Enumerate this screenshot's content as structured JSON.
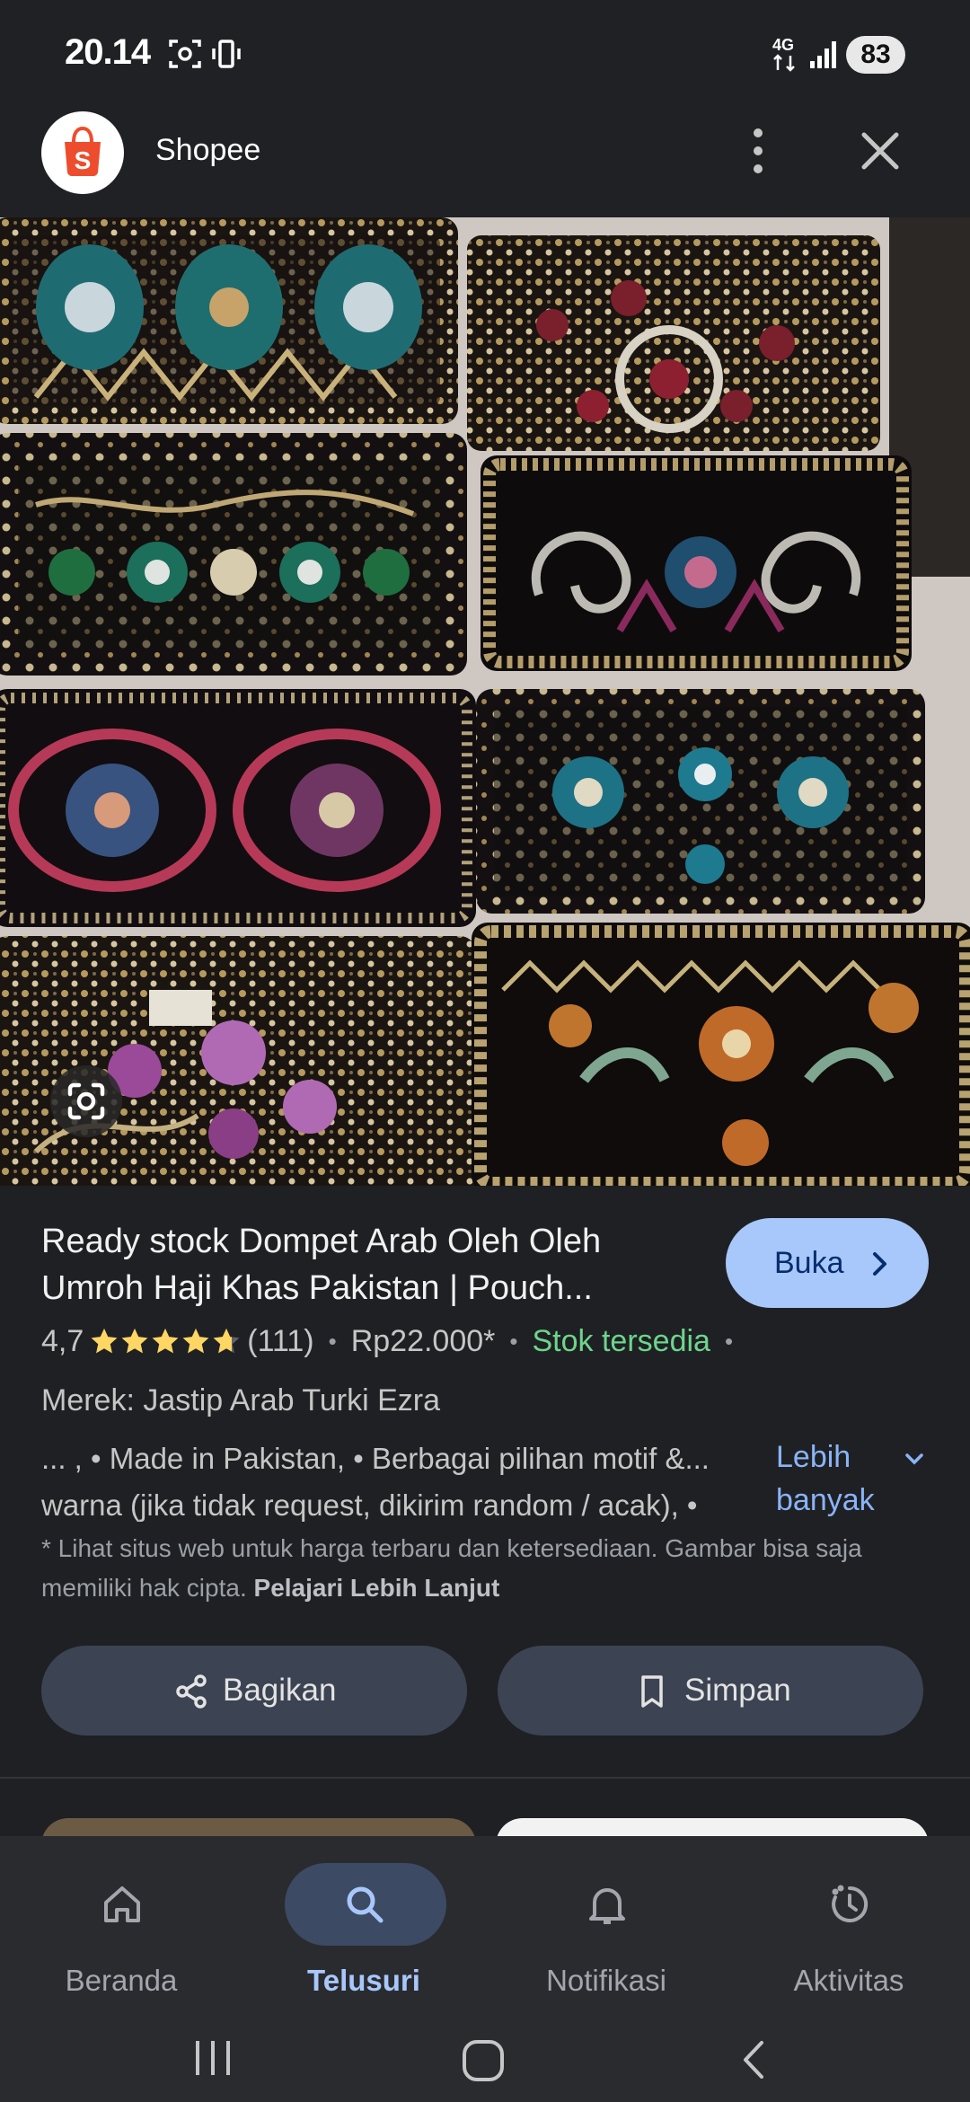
{
  "status_bar": {
    "time": "20.14",
    "network": "4G",
    "battery": "83"
  },
  "source": {
    "name": "Shopee",
    "logo_letter": "S",
    "logo_color": "#ee4d2d"
  },
  "product": {
    "title_line1": "Ready stock Dompet Arab Oleh Oleh",
    "title_line2": "Umroh Haji Khas Pakistan | Pouch...",
    "open_label": "Buka",
    "rating": "4,7",
    "rating_value": 4.7,
    "review_count": "(111)",
    "price": "Rp22.000*",
    "stock": "Stok tersedia",
    "brand": "Merek: Jastip Arab Turki Ezra",
    "description_line1": "... , • Made in Pakistan, • Berbagai pilihan motif &...",
    "description_line2": "warna (jika tidak request, dikirim random / acak), •",
    "more_label_line1": "Lebih",
    "more_label_line2": "banyak",
    "disclaimer": "* Lihat situs web untuk harga terbaru dan ketersediaan. Gambar bisa saja memiliki hak cipta.",
    "disclaimer_link": "Pelajari Lebih Lanjut"
  },
  "actions": {
    "share": "Bagikan",
    "save": "Simpan"
  },
  "bottom_nav": [
    {
      "label": "Beranda",
      "icon": "home-icon",
      "active": false
    },
    {
      "label": "Telusuri",
      "icon": "search-icon",
      "active": true
    },
    {
      "label": "Notifikasi",
      "icon": "bell-icon",
      "active": false
    },
    {
      "label": "Aktivitas",
      "icon": "activity-icon",
      "active": false
    }
  ],
  "colors": {
    "accent": "#a8c7fa",
    "link": "#8ab4f8",
    "stock_green": "#6dd58c",
    "star": "#fdd663"
  }
}
